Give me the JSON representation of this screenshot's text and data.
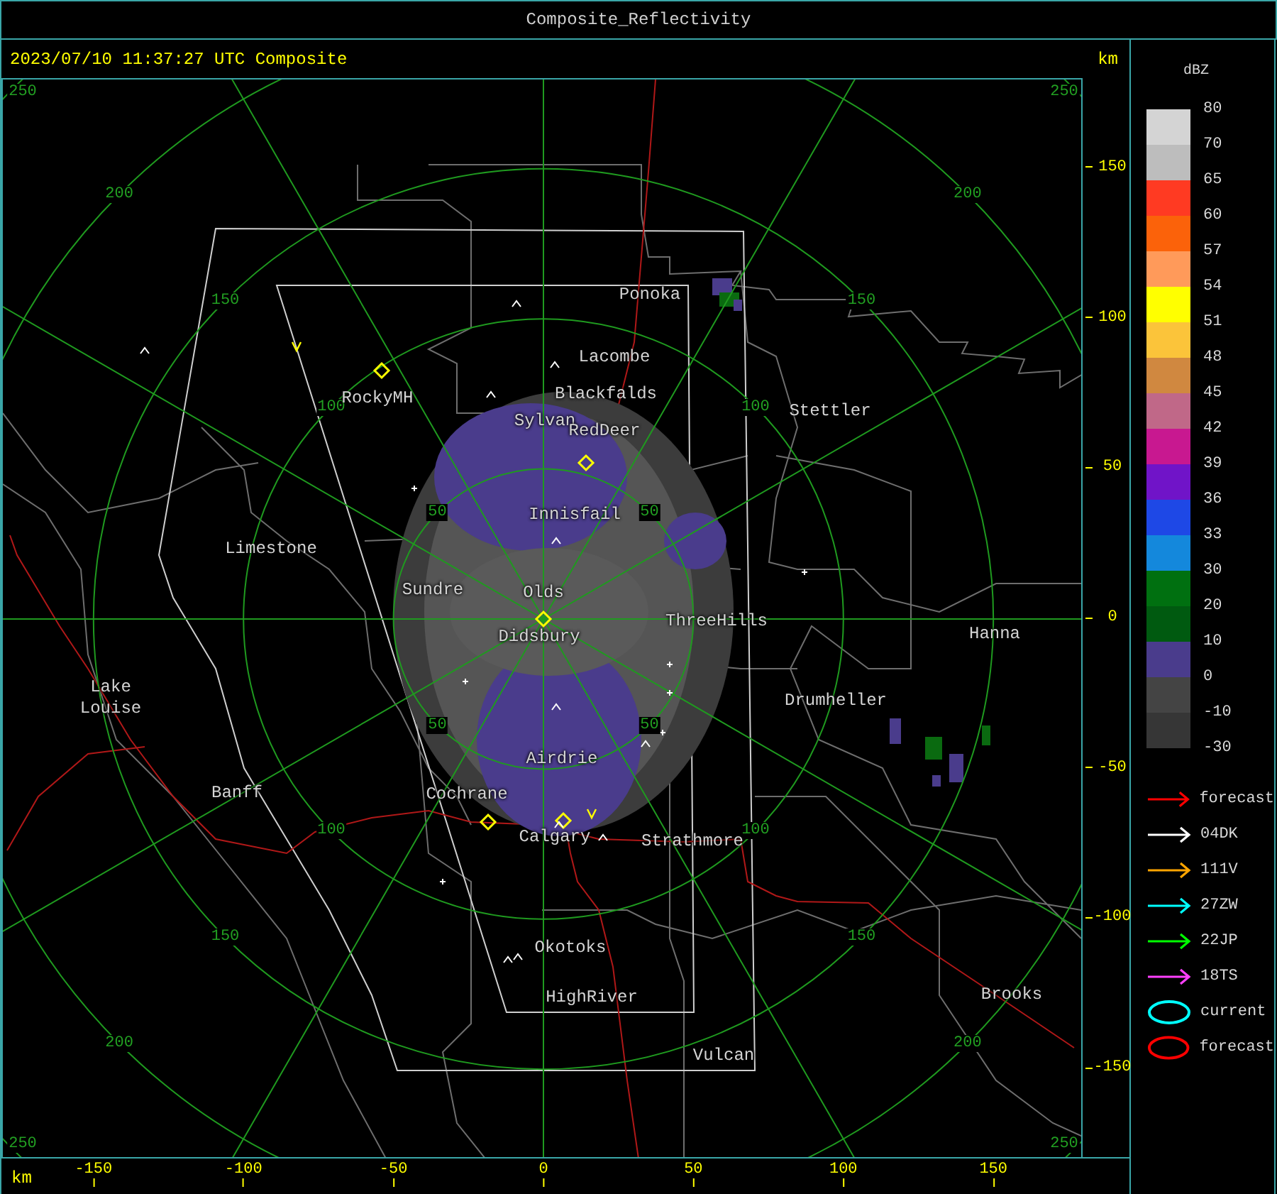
{
  "window": {
    "title": "Composite_Reflectivity"
  },
  "map": {
    "timestamp": "2023/07/10 11:37:27 UTC Composite",
    "unit_top": "km",
    "unit_bottom": "km",
    "y_ticks": [
      "150",
      "100",
      "50",
      "0",
      "-50",
      "-100",
      "-150"
    ],
    "x_ticks": [
      "-150",
      "-100",
      "-50",
      "0",
      "50",
      "100",
      "150"
    ],
    "range_rings": [
      {
        "labels": [
          "50",
          "50",
          "50",
          "50"
        ]
      },
      {
        "labels": [
          "100",
          "100",
          "100",
          "100"
        ]
      },
      {
        "labels": [
          "150",
          "150",
          "150",
          "150"
        ]
      },
      {
        "labels": [
          "200",
          "200",
          "200",
          "200"
        ]
      },
      {
        "labels": [
          "250",
          "250",
          "250",
          "250"
        ]
      }
    ],
    "places": [
      {
        "name": "Ponoka"
      },
      {
        "name": "Lacombe"
      },
      {
        "name": "Blackfalds"
      },
      {
        "name": "RockyMH"
      },
      {
        "name": "Sylvan"
      },
      {
        "name": "RedDeer"
      },
      {
        "name": "Stettler"
      },
      {
        "name": "Innisfail"
      },
      {
        "name": "Limestone"
      },
      {
        "name": "Sundre"
      },
      {
        "name": "Olds"
      },
      {
        "name": "ThreeHills"
      },
      {
        "name": "Didsbury"
      },
      {
        "name": "Hanna"
      },
      {
        "name": "Lake Louise"
      },
      {
        "name": "Drumheller"
      },
      {
        "name": "Airdrie"
      },
      {
        "name": "Banff"
      },
      {
        "name": "Cochrane"
      },
      {
        "name": "Calgary"
      },
      {
        "name": "Strathmore"
      },
      {
        "name": "Okotoks"
      },
      {
        "name": "HighRiver"
      },
      {
        "name": "Brooks"
      },
      {
        "name": "Vulcan"
      }
    ]
  },
  "legend": {
    "unit": "dBZ",
    "bottom_label": "-30",
    "levels": [
      {
        "label": "80",
        "color": "#d4d4d4"
      },
      {
        "label": "70",
        "color": "#bdbdbd"
      },
      {
        "label": "65",
        "color": "#ff3a22"
      },
      {
        "label": "60",
        "color": "#fb620a"
      },
      {
        "label": "57",
        "color": "#ff9a5a"
      },
      {
        "label": "54",
        "color": "#ffff00"
      },
      {
        "label": "51",
        "color": "#fbc43a"
      },
      {
        "label": "48",
        "color": "#d08840"
      },
      {
        "label": "45",
        "color": "#c06888"
      },
      {
        "label": "42",
        "color": "#c81890"
      },
      {
        "label": "39",
        "color": "#7014c8"
      },
      {
        "label": "36",
        "color": "#1e48e6"
      },
      {
        "label": "33",
        "color": "#1488dc"
      },
      {
        "label": "30",
        "color": "#007010"
      },
      {
        "label": "20",
        "color": "#005a10"
      },
      {
        "label": "10",
        "color": "#4a3c8c"
      },
      {
        "label": "0",
        "color": "#444444"
      },
      {
        "label": "-10",
        "color": "#363636"
      }
    ],
    "tracks": [
      {
        "kind": "arrow",
        "label": "forecast",
        "color": "#ff0000"
      },
      {
        "kind": "arrow",
        "label": "04DK",
        "color": "#ffffff"
      },
      {
        "kind": "arrow",
        "label": "111V",
        "color": "#ffa500"
      },
      {
        "kind": "arrow",
        "label": "27ZW",
        "color": "#00ffff"
      },
      {
        "kind": "arrow",
        "label": "22JP",
        "color": "#00ff00"
      },
      {
        "kind": "arrow",
        "label": "18TS",
        "color": "#ff40ff"
      },
      {
        "kind": "ellipse",
        "label": "current",
        "color": "#00ffff"
      },
      {
        "kind": "ellipse",
        "label": "forecast",
        "color": "#ff0000"
      }
    ]
  }
}
